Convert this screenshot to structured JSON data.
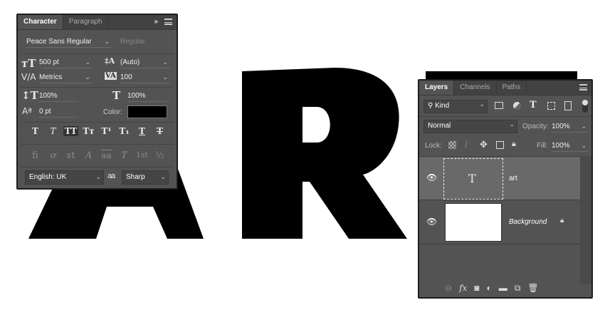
{
  "canvas": {
    "letters": [
      "A",
      "R"
    ]
  },
  "character": {
    "tabs": [
      "Character",
      "Paragraph"
    ],
    "font_family": "Peace Sans Regular",
    "font_style": "Regular",
    "size": "500 pt",
    "leading": "(Auto)",
    "kerning": "Metrics",
    "tracking": "100",
    "vscale": "100%",
    "hscale": "100%",
    "baseline": "0 pt",
    "color_label": "Color:",
    "color": "#000000",
    "style_buttons": [
      "T",
      "T",
      "TT",
      "Tт",
      "T¹",
      "T₁",
      "T",
      "T"
    ],
    "opentype_buttons": [
      "fi",
      "ơ",
      "st",
      "A",
      "aa",
      "T",
      "1st",
      "½"
    ],
    "language": "English: UK",
    "aa_icon": "a a",
    "antialias": "Sharp"
  },
  "layers": {
    "tabs": [
      "Layers",
      "Channels",
      "Paths"
    ],
    "filter": "Kind",
    "blend": "Normal",
    "opacity_label": "Opacity:",
    "opacity": "100%",
    "lock_label": "Lock:",
    "fill_label": "Fill:",
    "fill": "100%",
    "items": [
      {
        "name": "art",
        "thumb": "T",
        "selected": true
      },
      {
        "name": "Background",
        "locked": true
      }
    ]
  }
}
